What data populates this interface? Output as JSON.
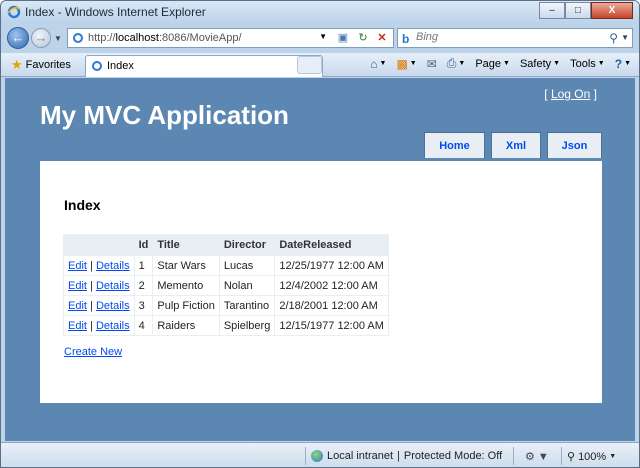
{
  "window": {
    "title": "Index - Windows Internet Explorer",
    "minimize": "–",
    "maximize": "□",
    "close": "X"
  },
  "address_bar": {
    "url_prefix": "http://",
    "url_host": "localhost",
    "url_rest": ":8086/MovieApp/"
  },
  "search": {
    "placeholder": "Bing"
  },
  "toolbar": {
    "favorites_label": "Favorites",
    "tab_label": "Index",
    "page_label": "Page",
    "safety_label": "Safety",
    "tools_label": "Tools"
  },
  "site": {
    "title": "My MVC Application",
    "login_open": "[",
    "login_link": "Log On",
    "login_close": "]",
    "menu": {
      "home": "Home",
      "xml": "Xml",
      "json": "Json"
    }
  },
  "page": {
    "heading": "Index",
    "create_new": "Create New",
    "table": {
      "headers": [
        "",
        "Id",
        "Title",
        "Director",
        "DateReleased"
      ],
      "edit_label": "Edit",
      "separator": "|",
      "details_label": "Details",
      "rows": [
        {
          "id": "1",
          "title": "Star Wars",
          "director": "Lucas",
          "date": "12/25/1977 12:00 AM"
        },
        {
          "id": "2",
          "title": "Memento",
          "director": "Nolan",
          "date": "12/4/2002 12:00 AM"
        },
        {
          "id": "3",
          "title": "Pulp Fiction",
          "director": "Tarantino",
          "date": "2/18/2001 12:00 AM"
        },
        {
          "id": "4",
          "title": "Raiders",
          "director": "Spielberg",
          "date": "12/15/1977 12:00 AM"
        }
      ]
    }
  },
  "status": {
    "zone": "Local intranet",
    "protected_mode": "Protected Mode: Off",
    "zoom": "100%"
  },
  "colors": {
    "site_background": "#5c87b2",
    "link": "#034af3",
    "table_header": "#e8eef4"
  }
}
